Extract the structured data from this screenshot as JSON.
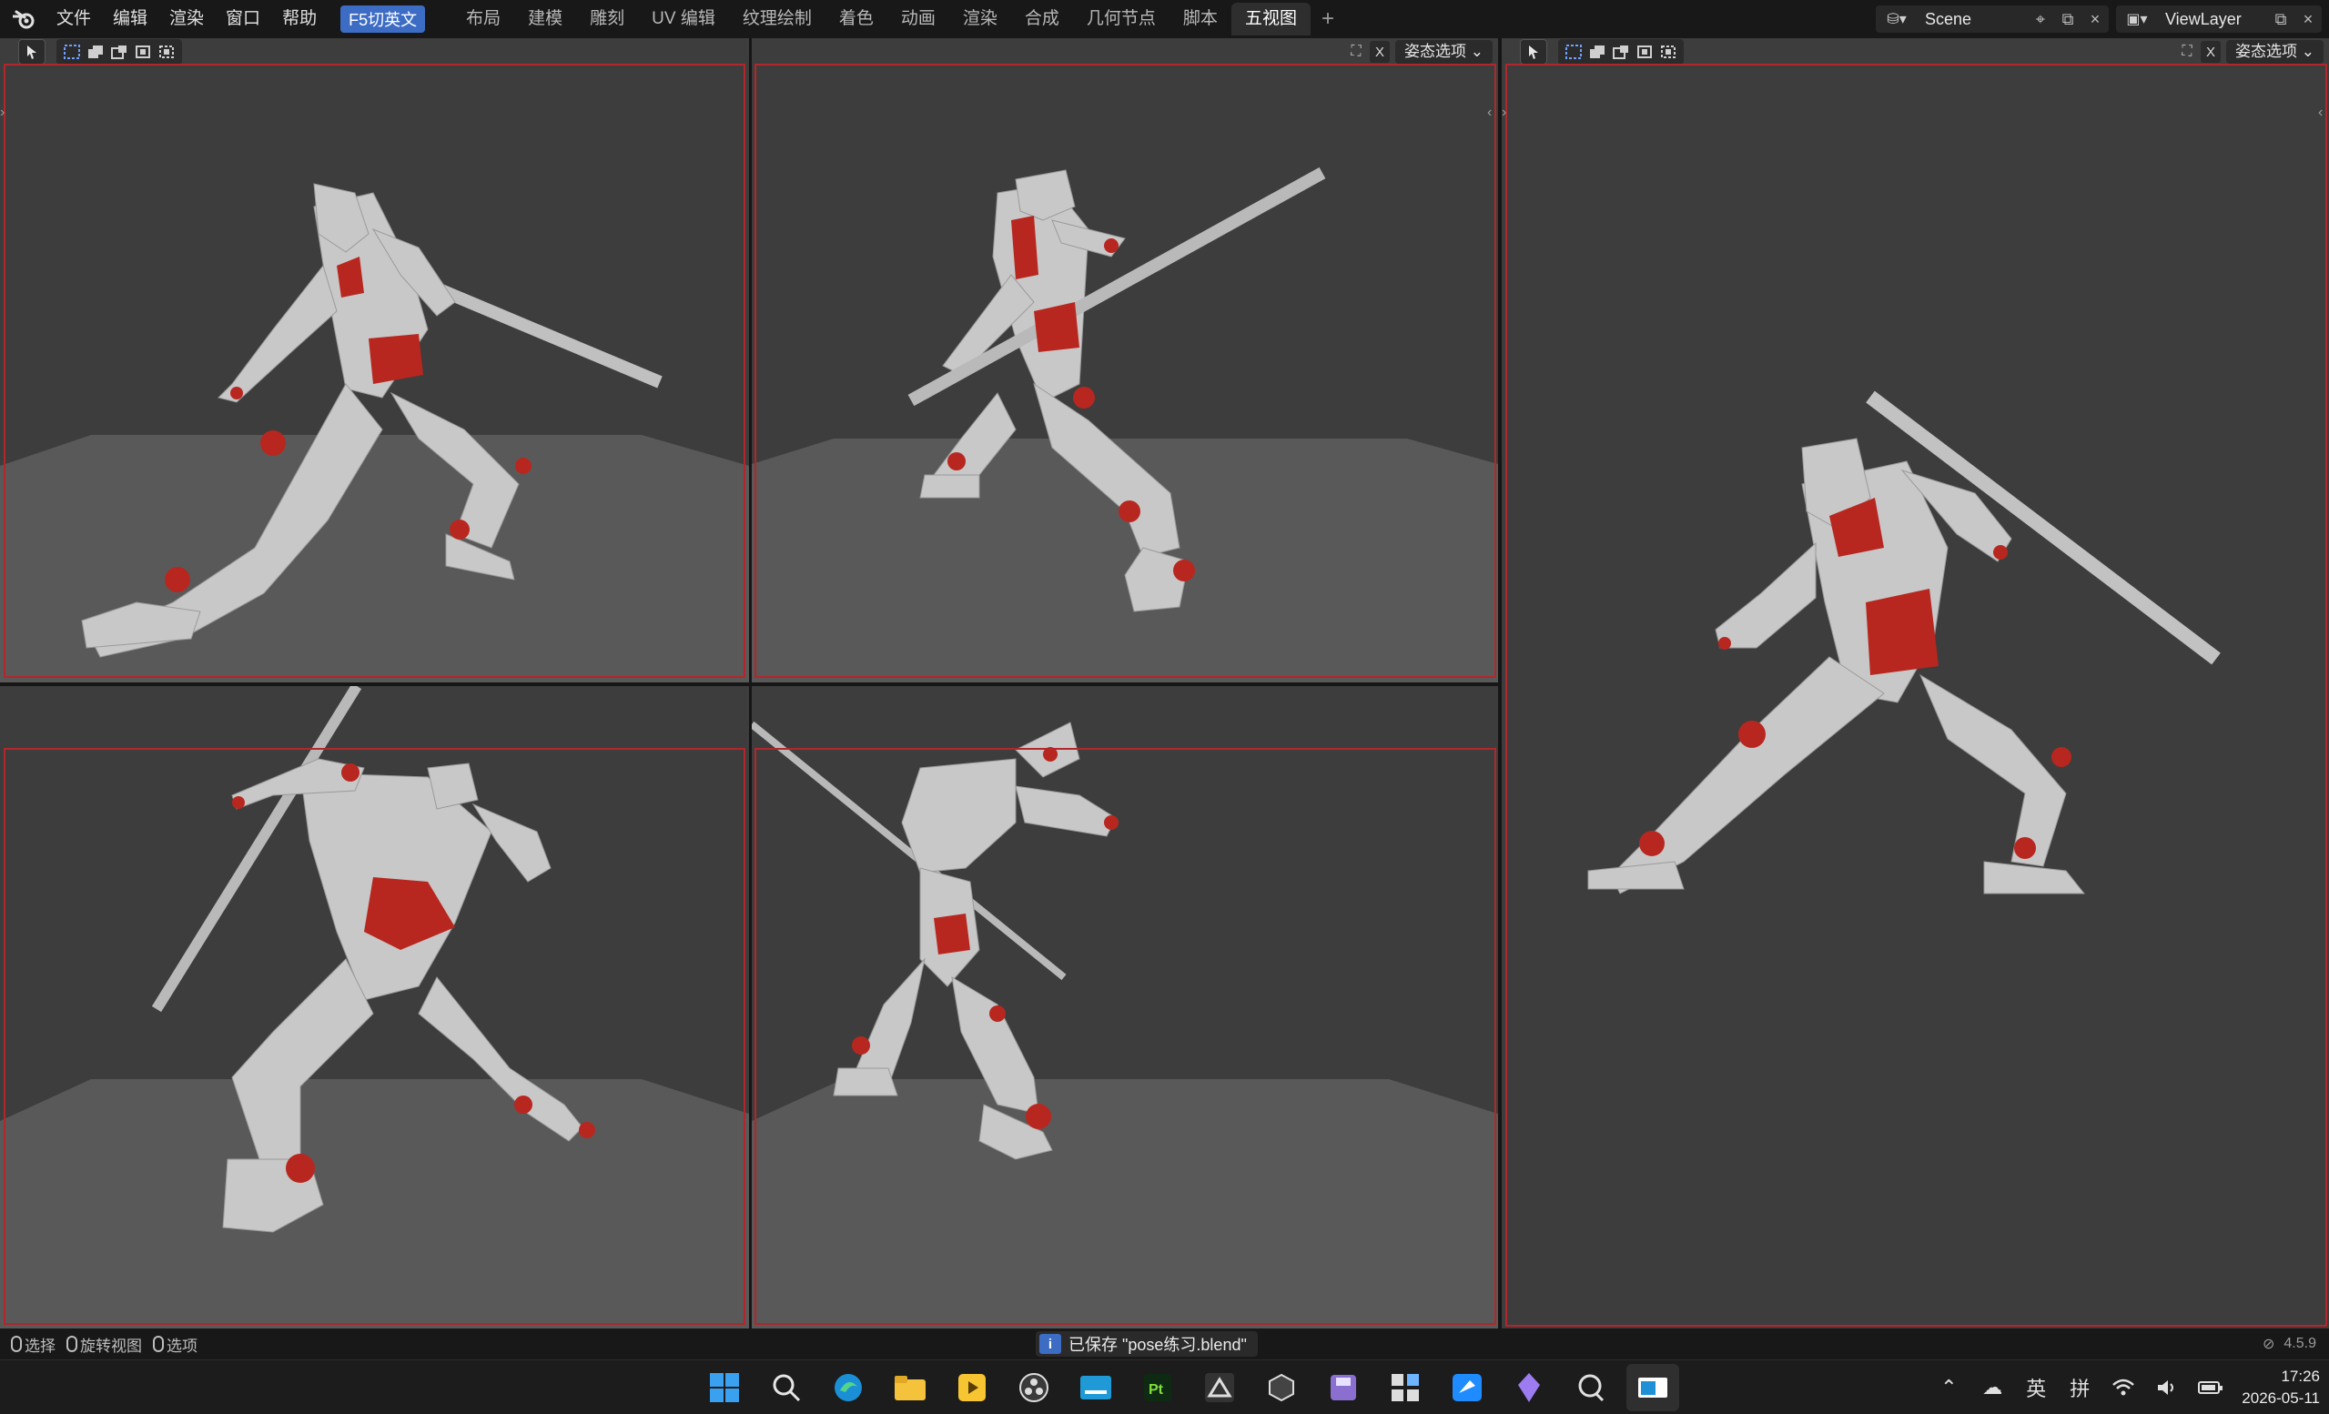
{
  "menu": [
    "文件",
    "编辑",
    "渲染",
    "窗口",
    "帮助"
  ],
  "lang_toggle": "F5切英文",
  "workspace_tabs": [
    "布局",
    "建模",
    "雕刻",
    "UV 编辑",
    "纹理绘制",
    "着色",
    "动画",
    "渲染",
    "合成",
    "几何节点",
    "脚本",
    "五视图"
  ],
  "active_tab": "五视图",
  "scene": {
    "name": "Scene",
    "view_layer": "ViewLayer"
  },
  "viewport": {
    "x_label": "X",
    "pose_options": "姿态选项"
  },
  "status": {
    "hints": [
      "选择",
      "旋转视图",
      "选项"
    ],
    "saved_message": "已保存 \"pose练习.blend\"",
    "version": "4.5.9"
  },
  "taskbar": {
    "apps": [
      "windows-start",
      "search",
      "edge",
      "file-explorer",
      "potplayer",
      "obs",
      "editor",
      "pt",
      "zbrush",
      "unity",
      "save-tool",
      "calculator",
      "feishu",
      "crystal-app",
      "audio-app",
      "blender"
    ],
    "tray": {
      "ime_lang": "英",
      "ime_mode": "拼",
      "time": "17:26",
      "date": "2026-05-11"
    }
  },
  "colors": {
    "accent": "#3d6cc4",
    "frame": "#b3262b",
    "mannequin": "#c8c8c8",
    "joint": "#b8271f"
  }
}
